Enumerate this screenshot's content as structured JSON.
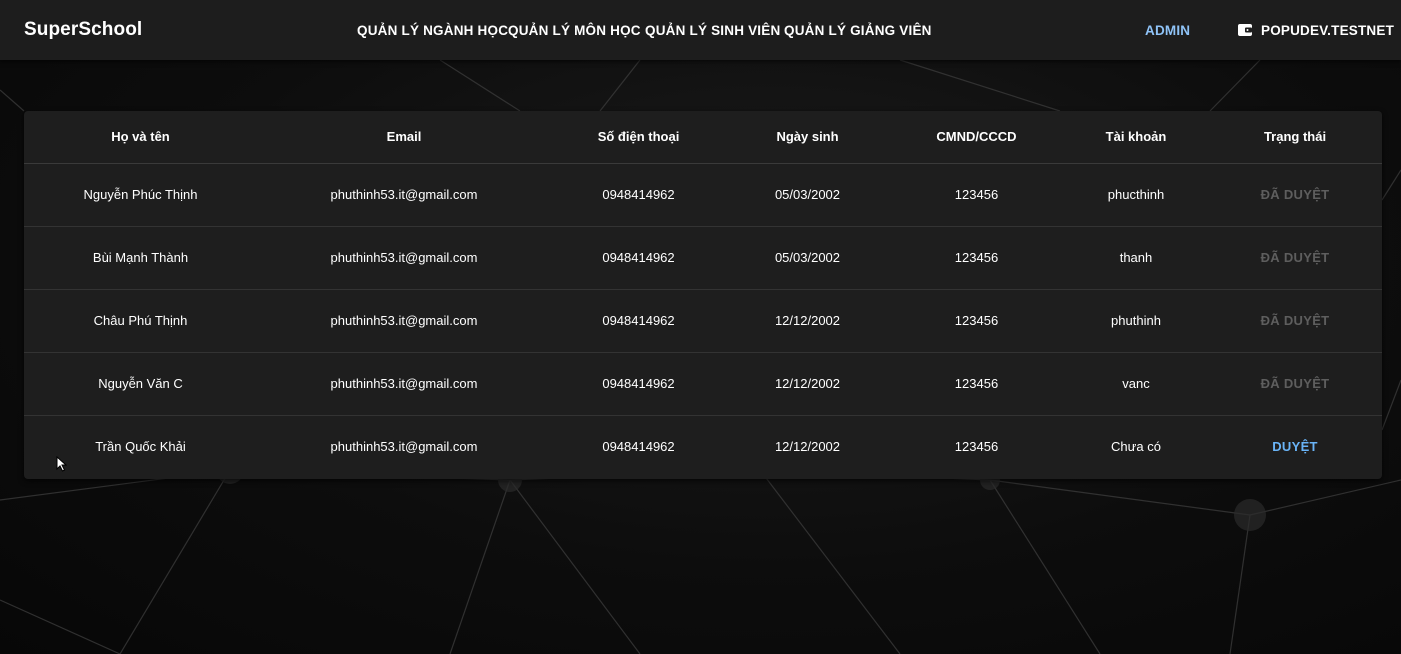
{
  "app": {
    "brand": "SuperSchool"
  },
  "nav": {
    "items": [
      {
        "label": "QUẢN LÝ NGÀNH HỌC"
      },
      {
        "label": "QUẢN LÝ MÔN HỌC"
      },
      {
        "label": "QUẢN LÝ SINH VIÊN"
      },
      {
        "label": "QUẢN LÝ GIẢNG VIÊN"
      }
    ],
    "admin": "ADMIN",
    "wallet": "POPUDEV.TESTNET"
  },
  "table": {
    "headers": [
      "Họ và tên",
      "Email",
      "Số điện thoại",
      "Ngày sinh",
      "CMND/CCCD",
      "Tài khoản",
      "Trạng thái"
    ],
    "rows": [
      {
        "name": "Nguyễn Phúc Thịnh",
        "email": "phuthinh53.it@gmail.com",
        "phone": "0948414962",
        "dob": "05/03/2002",
        "id_card": "123456",
        "account": "phucthinh",
        "status": "ĐÃ DUYỆT"
      },
      {
        "name": "Bùi Mạnh Thành",
        "email": "phuthinh53.it@gmail.com",
        "phone": "0948414962",
        "dob": "05/03/2002",
        "id_card": "123456",
        "account": "thanh",
        "status": "ĐÃ DUYỆT"
      },
      {
        "name": "Châu Phú Thịnh",
        "email": "phuthinh53.it@gmail.com",
        "phone": "0948414962",
        "dob": "12/12/2002",
        "id_card": "123456",
        "account": "phuthinh",
        "status": "ĐÃ DUYỆT"
      },
      {
        "name": "Nguyễn Văn C",
        "email": "phuthinh53.it@gmail.com",
        "phone": "0948414962",
        "dob": "12/12/2002",
        "id_card": "123456",
        "account": "vanc",
        "status": "ĐÃ DUYỆT"
      },
      {
        "name": "Trần Quốc Khải",
        "email": "phuthinh53.it@gmail.com",
        "phone": "0948414962",
        "dob": "12/12/2002",
        "id_card": "123456",
        "account": "Chưa có",
        "status": "DUYỆT"
      }
    ]
  },
  "colors": {
    "background": "#0c0c0c",
    "appbar": "#1d1d1d",
    "card": "#1e1e1e",
    "admin_link": "#8fc3f7",
    "approve_button": "#6ab4f7",
    "approved_text": "#5e5e5e"
  },
  "icons": {
    "wallet": "wallet-icon",
    "cursor": "mouse-pointer-icon"
  }
}
